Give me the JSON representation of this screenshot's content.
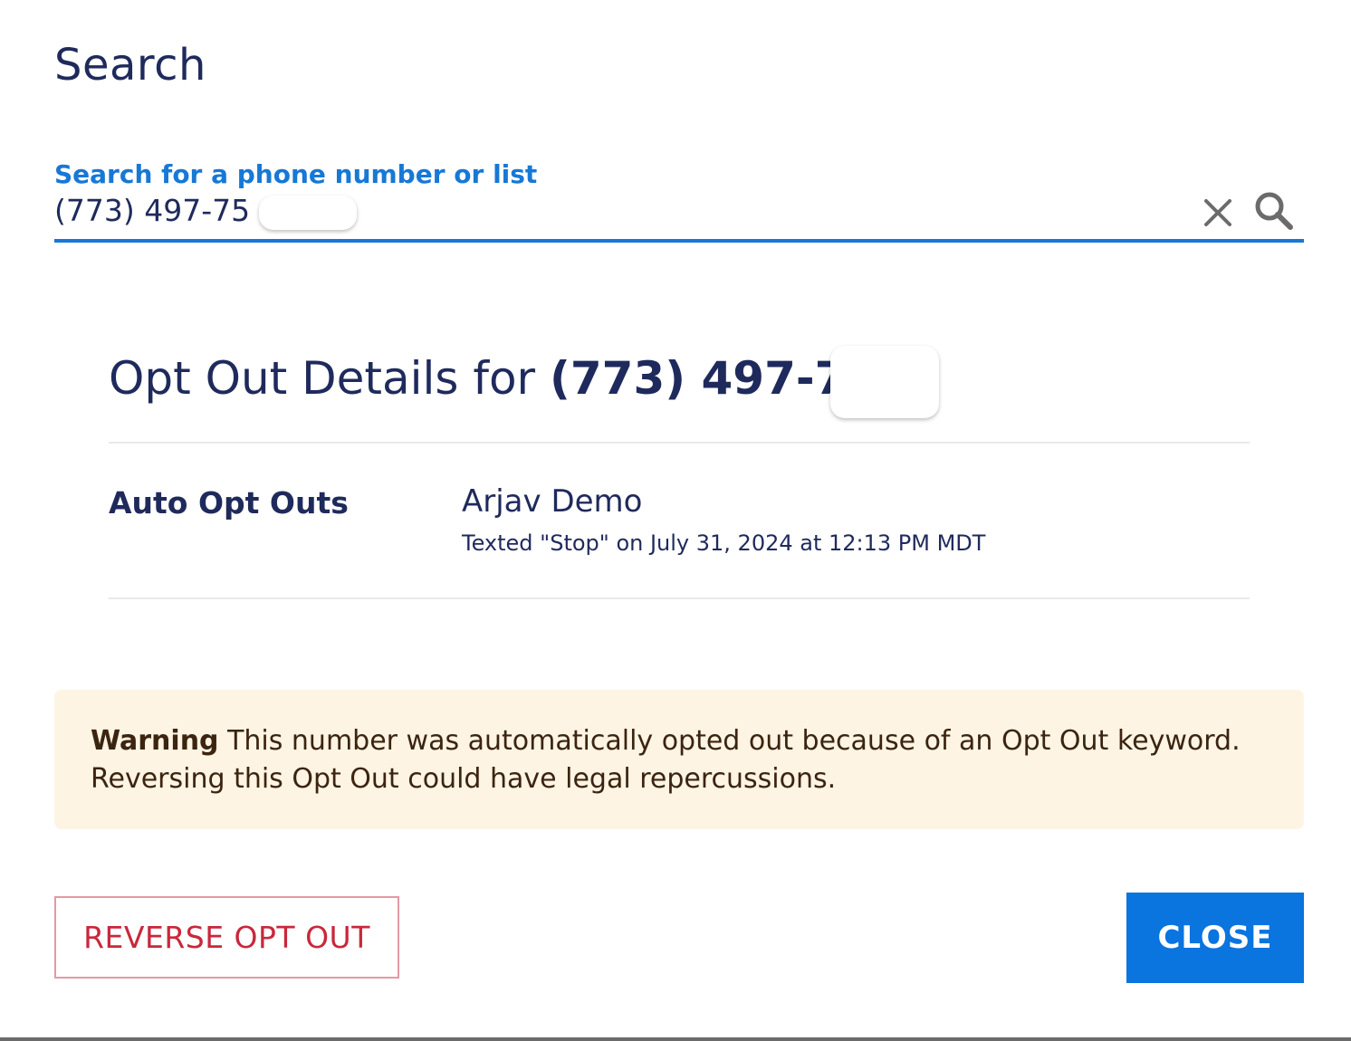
{
  "dialog": {
    "title": "Search"
  },
  "search": {
    "label": "Search for a phone number or list",
    "value": "(773) 497-75",
    "clear_icon": "close-icon",
    "search_icon": "search-icon"
  },
  "details": {
    "title_prefix": "Opt Out Details for ",
    "phone": "(773) 497-75",
    "section_label": "Auto Opt Outs",
    "name": "Arjav Demo",
    "description": "Texted \"Stop\" on July 31, 2024 at 12:13 PM MDT"
  },
  "warning": {
    "label": "Warning",
    "text": " This number was automatically opted out because of an Opt Out keyword. Reversing this Opt Out could have legal repercussions."
  },
  "actions": {
    "reverse_label": "REVERSE OPT OUT",
    "close_label": "CLOSE"
  },
  "colors": {
    "primary": "#0a74df",
    "text": "#1f2a5c",
    "danger": "#c8283c",
    "warning_bg": "#fdf4e3"
  }
}
